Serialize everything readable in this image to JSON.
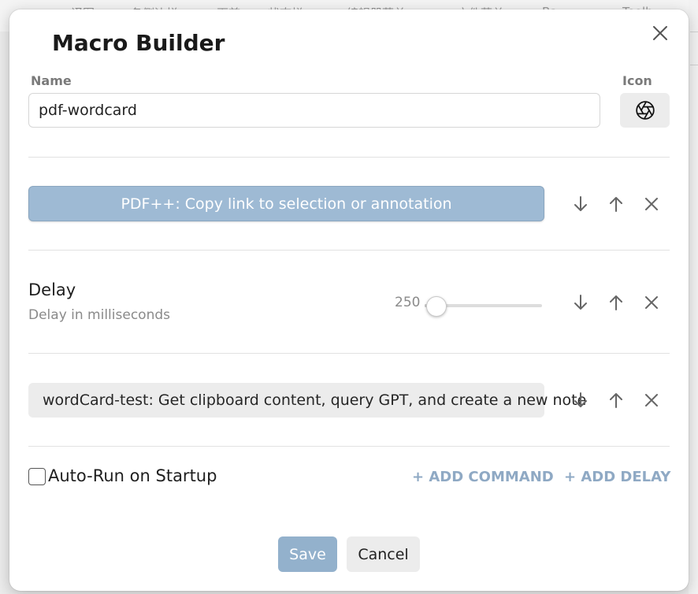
{
  "background": {
    "menu_items": [
      "译图",
      "各侧边栏",
      "页首",
      "状态栏",
      "编辑器菜单",
      "文件菜单",
      "Ba",
      "Toolb"
    ]
  },
  "modal": {
    "title": "Macro Builder",
    "close_icon": "close-icon",
    "name_label": "Name",
    "name_value": "pdf-wordcard",
    "icon_label": "Icon",
    "icon_name": "aperture-icon",
    "commands": [
      {
        "text": "PDF++: Copy link to selection or annotation",
        "style": "primary"
      },
      {
        "delay": {
          "title": "Delay",
          "description": "Delay in milliseconds",
          "value": "250",
          "level": 0.02
        }
      },
      {
        "text": "wordCard-test: Get clipboard content, query GPT, and create a new note",
        "style": "secondary"
      }
    ],
    "row_controls": {
      "move_down_icon": "arrow-down-icon",
      "move_up_icon": "arrow-up-icon",
      "remove_icon": "close-icon"
    },
    "auto_run": {
      "label": "Auto-Run on Startup",
      "checked": false
    },
    "add_command_label": "+ ADD COMMAND",
    "add_delay_label": "+ ADD DELAY",
    "save_label": "Save",
    "cancel_label": "Cancel"
  },
  "colors": {
    "accent": "#9ebad4",
    "save_button": "#93b1cc",
    "link": "#8fa9c4"
  }
}
